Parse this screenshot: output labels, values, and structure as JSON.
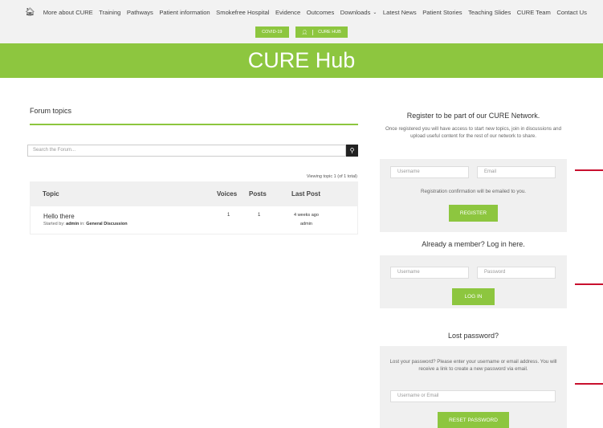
{
  "nav": {
    "home_icon": "home-icon",
    "items": [
      {
        "label": "More about CURE"
      },
      {
        "label": "Training"
      },
      {
        "label": "Pathways"
      },
      {
        "label": "Patient information"
      },
      {
        "label": "Smokefree Hospital"
      },
      {
        "label": "Evidence"
      },
      {
        "label": "Outcomes"
      },
      {
        "label": "Downloads",
        "dropdown": true
      },
      {
        "label": "Latest News"
      },
      {
        "label": "Patient Stories"
      },
      {
        "label": "Teaching Slides"
      },
      {
        "label": "CURE Team"
      },
      {
        "label": "Contact Us"
      }
    ],
    "sub": {
      "covid": "COVID-19",
      "hub": "CURE HUB",
      "hub_icon": "user-icon"
    }
  },
  "hero": {
    "title": "CURE Hub"
  },
  "forum": {
    "title": "Forum topics",
    "search_placeholder": "Search the Forum...",
    "viewing": "Viewing topic 1 (of 1 total)",
    "columns": {
      "topic": "Topic",
      "voices": "Voices",
      "posts": "Posts",
      "last_post": "Last Post"
    },
    "rows": [
      {
        "topic": "Hello there",
        "started_by_label": "Started by:",
        "author": "admin",
        "in_label": "in:",
        "forum": "General Discussion",
        "voices": "1",
        "posts": "1",
        "last_post_time": "4 weeks ago",
        "last_post_author": "admin"
      }
    ]
  },
  "register": {
    "title": "Register to be part of our CURE Network.",
    "description": "Once registered you will have access to start new topics, join in discussions and upload useful content for the rest of our network to share.",
    "username_placeholder": "Username",
    "email_placeholder": "Email",
    "note": "Registration confirmation will be emailed to you.",
    "button": "REGISTER"
  },
  "login": {
    "title": "Already a member? Log in here.",
    "username_placeholder": "Username",
    "password_placeholder": "Password",
    "button": "LOG IN"
  },
  "lost": {
    "title": "Lost password?",
    "description": "Lost your password? Please enter your username or email address. You will receive a link to create a new password via email.",
    "field_placeholder": "Username or Email",
    "button": "RESET PASSWORD"
  },
  "colors": {
    "accent": "#8dc63f",
    "red_marker": "#c8102e"
  }
}
